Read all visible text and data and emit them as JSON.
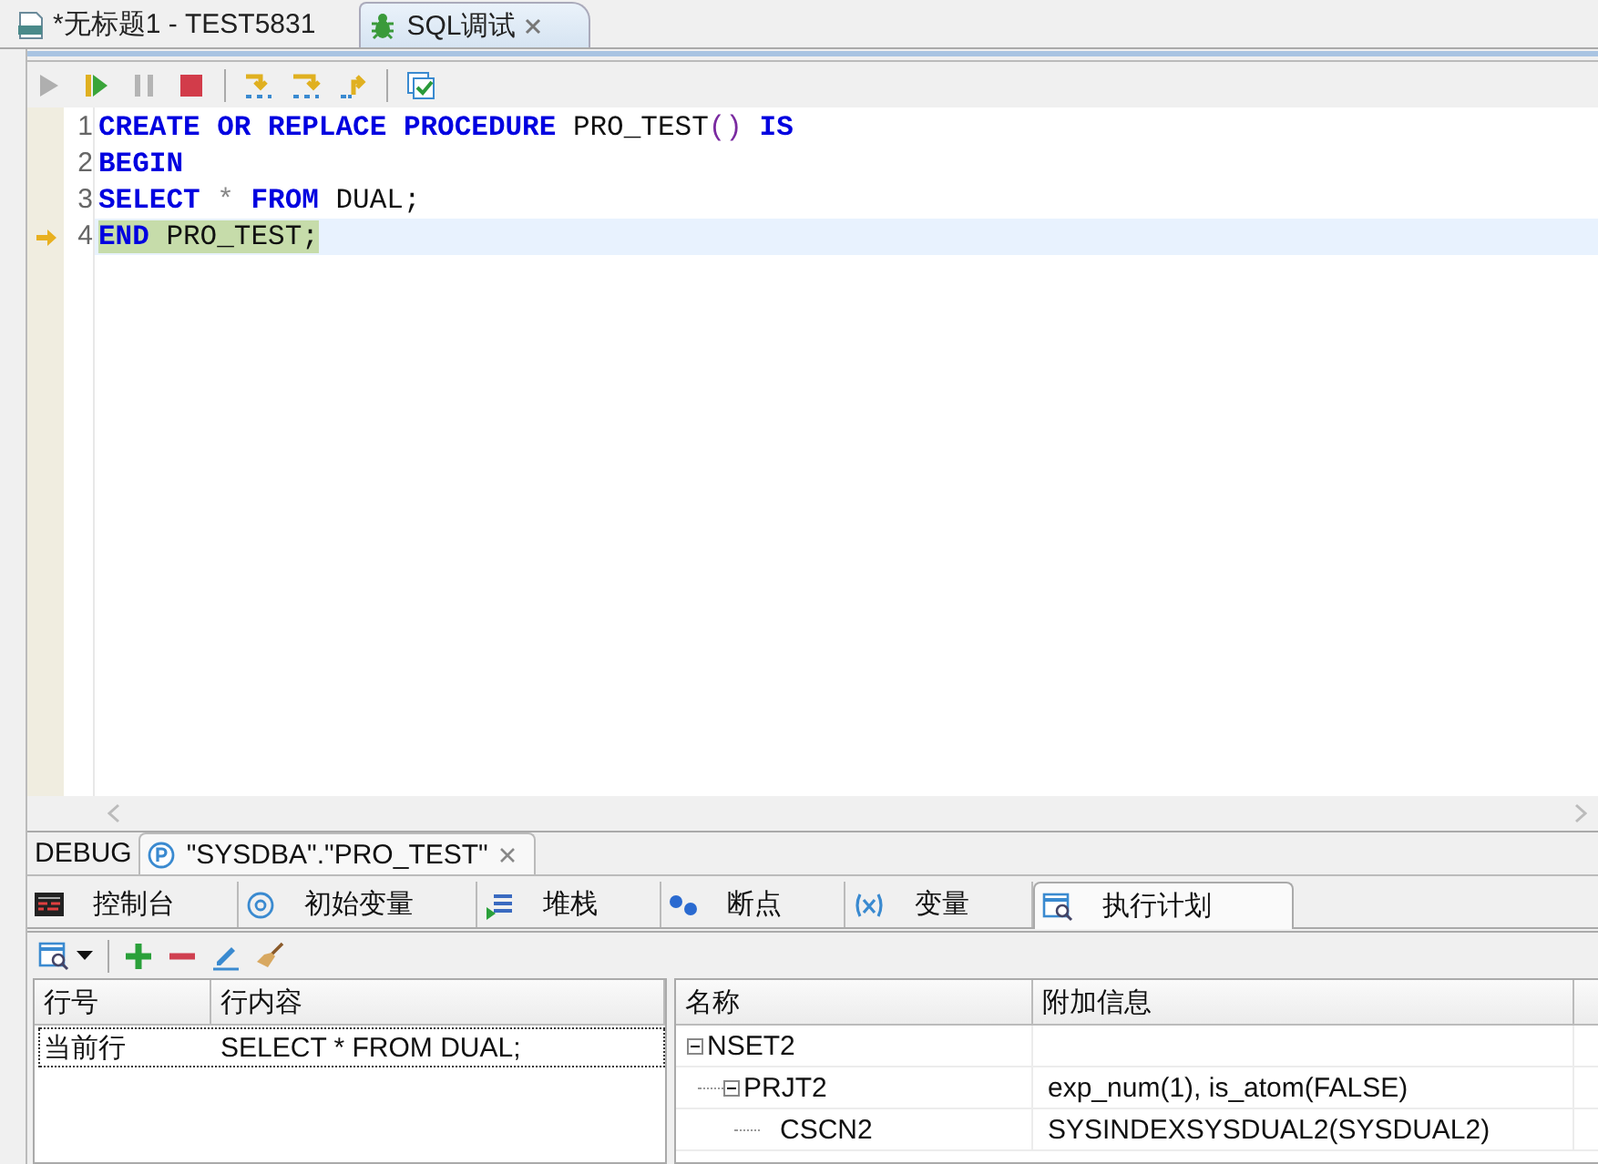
{
  "editor_tabs": [
    {
      "label": "*无标题1 - TEST5831",
      "kind": "sql",
      "selected": false,
      "closable": false
    },
    {
      "label": "SQL调试",
      "kind": "debug",
      "selected": true,
      "closable": true
    }
  ],
  "debug_toolbar": [
    {
      "kind": "run",
      "disabled": true
    },
    {
      "kind": "resume",
      "disabled": false
    },
    {
      "kind": "pause",
      "disabled": true
    },
    {
      "kind": "stop",
      "disabled": false
    },
    {
      "kind": "sep"
    },
    {
      "kind": "step_into",
      "disabled": false
    },
    {
      "kind": "step_over",
      "disabled": false
    },
    {
      "kind": "step_return",
      "disabled": false
    },
    {
      "kind": "sep"
    },
    {
      "kind": "check",
      "disabled": false
    }
  ],
  "code": {
    "lines": [
      {
        "number": "1",
        "current": false,
        "tokens": [
          {
            "text": "CREATE",
            "kind": "keyword"
          },
          {
            "text": " OR",
            "kind": "keyword"
          },
          {
            "text": " REPLACE",
            "kind": "keyword"
          },
          {
            "text": " PROCEDURE",
            "kind": "keyword"
          },
          {
            "text": " PRO_TEST",
            "kind": "ident"
          },
          {
            "text": "()",
            "kind": "paren"
          },
          {
            "text": " IS",
            "kind": "keyword"
          }
        ]
      },
      {
        "number": "2",
        "current": false,
        "tokens": [
          {
            "text": "BEGIN",
            "kind": "keyword"
          }
        ]
      },
      {
        "number": "3",
        "current": false,
        "tokens": [
          {
            "text": "SELECT",
            "kind": "keyword"
          },
          {
            "text": " *",
            "kind": "op"
          },
          {
            "text": " FROM",
            "kind": "keyword"
          },
          {
            "text": " DUAL;",
            "kind": "ident"
          }
        ]
      },
      {
        "number": "4",
        "current": true,
        "tokens": [
          {
            "text": "END",
            "kind": "keyword"
          },
          {
            "text": " PRO_TEST;",
            "kind": "ident"
          }
        ]
      }
    ]
  },
  "debug_bar": {
    "label": "DEBUG",
    "tabs": [
      {
        "label": "\"SYSDBA\".\"PRO_TEST\"",
        "selected": true
      }
    ]
  },
  "view_tabs": [
    {
      "label": "控制台",
      "kind": "console",
      "selected": false
    },
    {
      "label": "初始变量",
      "kind": "at",
      "selected": false
    },
    {
      "label": "堆栈",
      "kind": "stack",
      "selected": false
    },
    {
      "label": "断点",
      "kind": "breakpoints",
      "selected": false
    },
    {
      "label": "变量",
      "kind": "variables",
      "selected": false
    },
    {
      "label": "执行计划",
      "kind": "plan",
      "selected": true
    }
  ],
  "plan_toolbar": [
    {
      "kind": "plan_menu"
    },
    {
      "kind": "sep"
    },
    {
      "kind": "add"
    },
    {
      "kind": "remove"
    },
    {
      "kind": "edit"
    },
    {
      "kind": "clear"
    }
  ],
  "line_table": {
    "columns": [
      "行号",
      "行内容"
    ],
    "rows": [
      {
        "cells": [
          "当前行",
          "SELECT * FROM DUAL;"
        ],
        "selected": true
      }
    ]
  },
  "plan_tree": {
    "columns": [
      "名称",
      "附加信息"
    ],
    "nodes": [
      {
        "name": "NSET2",
        "expanded": true,
        "children": [
          {
            "name": "PRJT2",
            "info": "exp_num(1), is_atom(FALSE)",
            "expanded": true,
            "children": [
              {
                "name": "CSCN2",
                "info": "SYSINDEXSYSDUAL2(SYSDUAL2)"
              }
            ]
          }
        ]
      }
    ]
  }
}
